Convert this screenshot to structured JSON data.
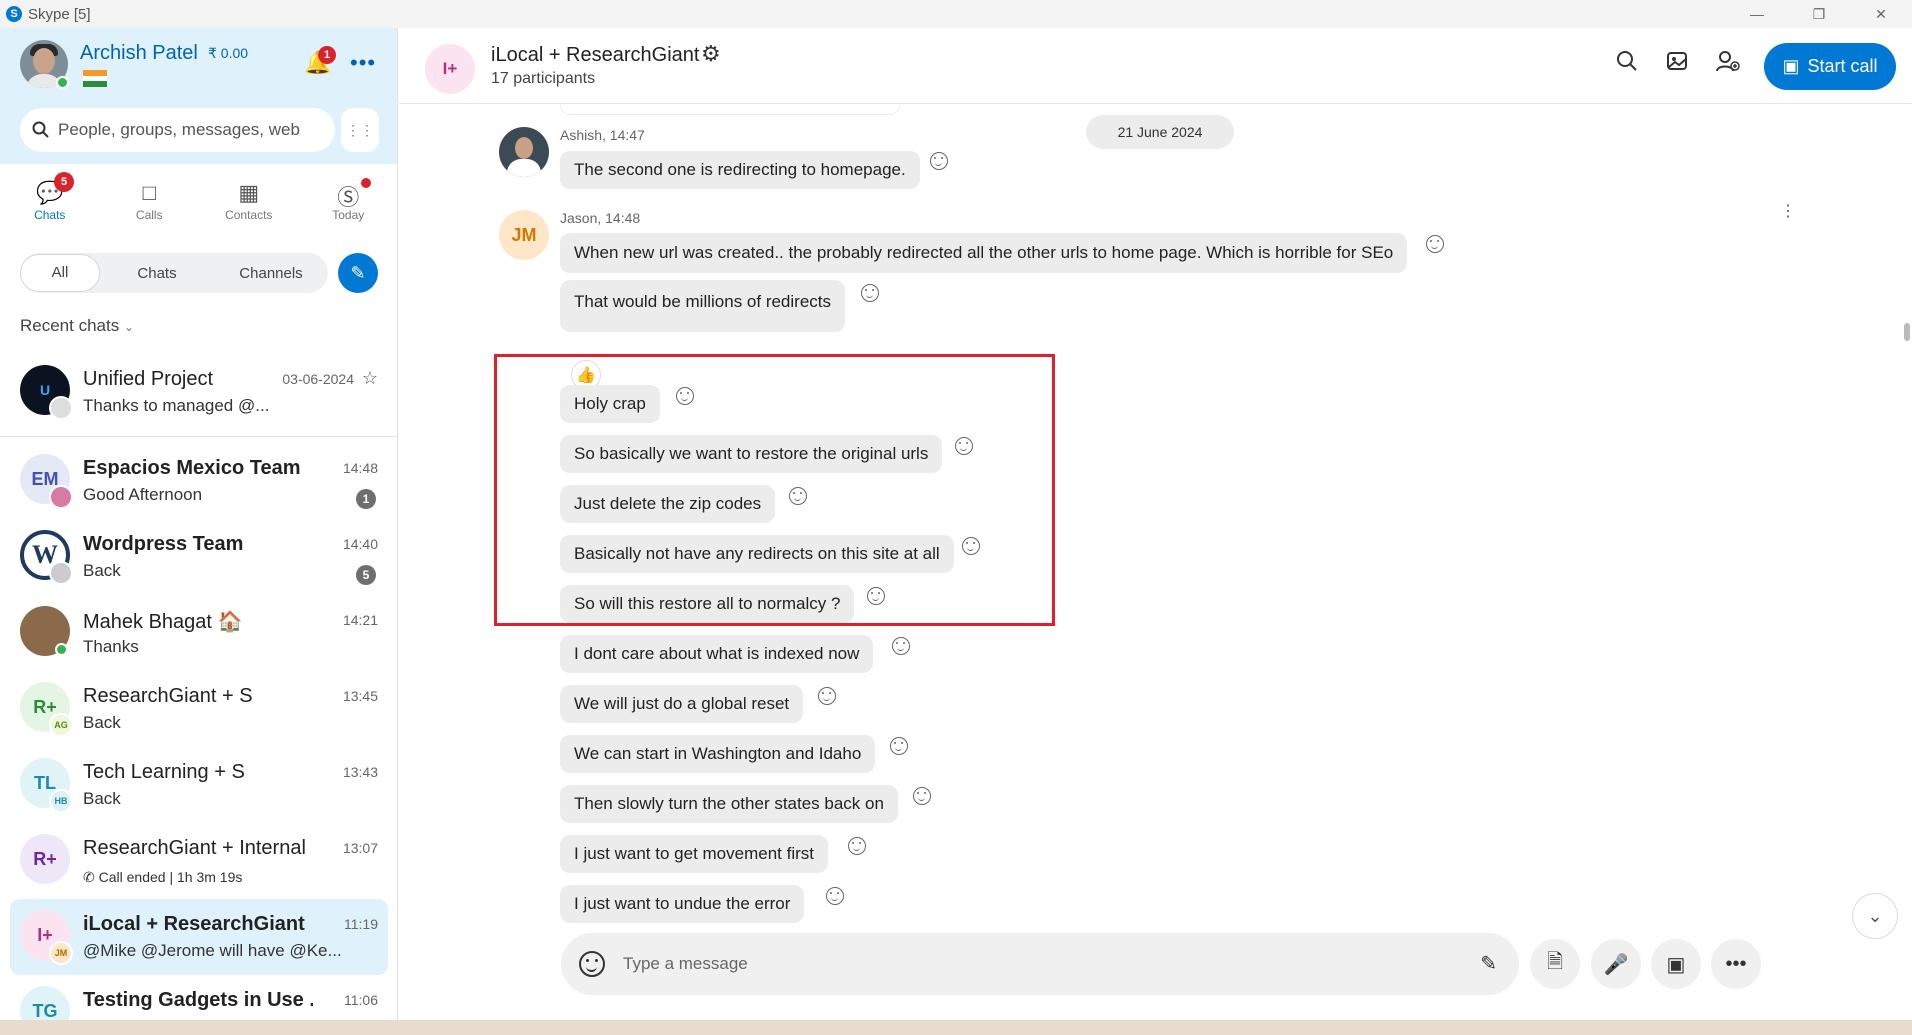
{
  "window": {
    "title": "Skype [5]",
    "logo": "S"
  },
  "profile": {
    "name": "Archish Patel",
    "credit": "₹ 0.00",
    "notifications": "1"
  },
  "search": {
    "placeholder": "People, groups, messages, web"
  },
  "nav": {
    "chats": {
      "label": "Chats",
      "badge": "5"
    },
    "calls": {
      "label": "Calls"
    },
    "contacts": {
      "label": "Contacts"
    },
    "today": {
      "label": "Today"
    }
  },
  "filters": {
    "all": "All",
    "chats": "Chats",
    "channels": "Channels"
  },
  "recent_label": "Recent chats",
  "chats": [
    {
      "name": "Unified Project",
      "preview": "Thanks to managed @...",
      "time": "03-06-2024",
      "initials": "U",
      "bold": false
    },
    {
      "name": "Espacios Mexico Team",
      "preview": "Good Afternoon",
      "time": "14:48",
      "count": "1",
      "initials": "EM",
      "bold": true
    },
    {
      "name": "Wordpress Team",
      "preview": "Back",
      "time": "14:40",
      "count": "5",
      "initials": "W",
      "bold": true
    },
    {
      "name": "Mahek Bhagat 🏠",
      "preview": "Thanks",
      "time": "14:21",
      "initials": "",
      "bold": false
    },
    {
      "name": "ResearchGiant + S",
      "preview": "Back",
      "time": "13:45",
      "initials": "R+",
      "sub": "AG",
      "bold": false
    },
    {
      "name": "Tech Learning + S",
      "preview": "Back",
      "time": "13:43",
      "initials": "TL",
      "sub": "HB",
      "bold": false
    },
    {
      "name": "ResearchGiant + Internal",
      "preview": "Call ended | 1h 3m 19s",
      "time": "13:07",
      "initials": "R+",
      "bold": false
    },
    {
      "name": "iLocal + ResearchGiant",
      "preview": "@Mike  @Jerome will have @Ke...",
      "time": "11:19",
      "initials": "I+",
      "sub": "JM",
      "bold": false
    },
    {
      "name": "Testing Gadgets in Use ...",
      "preview": "",
      "time": "11:06",
      "initials": "TG",
      "bold": true
    }
  ],
  "conversation": {
    "title": "iLocal + ResearchGiant",
    "participants": "17 participants",
    "avatar": "I+",
    "start_call": "Start call",
    "date_divider": "21 June 2024",
    "senders": {
      "ashish": "Ashish, 14:47",
      "jason": "Jason, 14:48",
      "jason_initials": "JM"
    },
    "messages": [
      "The second one is redirecting to homepage.",
      "When new url was created.. the probably redirected all the other urls to home page. Which is horrible for SEo",
      "That would be millions of redirects",
      "Holy crap",
      "So basically we want to restore the original urls",
      "Just delete the zip codes",
      "Basically not have any redirects on this site at all",
      "So will this restore all to normalcy ?",
      "I dont care about what is indexed now",
      "We will just do a global reset",
      "We can start in Washington and Idaho",
      "Then slowly turn the other states back on",
      "I just want to get movement first",
      "I just want to undue the error"
    ],
    "reaction": "👍"
  },
  "composer": {
    "placeholder": "Type a message"
  },
  "icons": {
    "search": "search-icon",
    "gallery": "gallery-icon",
    "add_person": "add-person-icon",
    "gear": "gear-icon",
    "bell": "bell-icon",
    "emoji": "emoji-icon"
  },
  "colors": {
    "accent": "#0078d4",
    "highlight_box": "#e0202a",
    "badge": "#d8242e"
  }
}
